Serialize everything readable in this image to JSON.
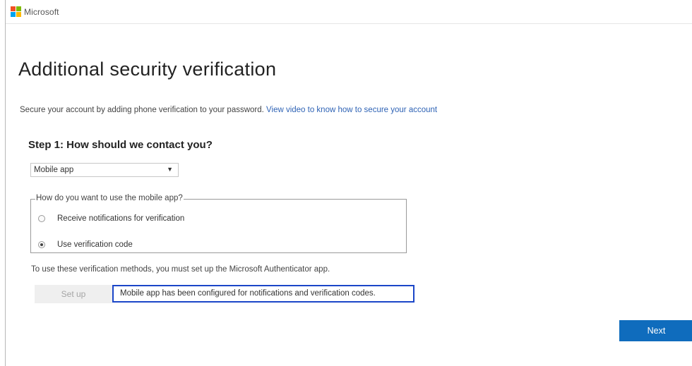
{
  "brand": {
    "name": "Microsoft",
    "logo_colors": [
      "#f25022",
      "#7fba00",
      "#00a4ef",
      "#ffb900"
    ]
  },
  "page": {
    "title": "Additional security verification",
    "intro_text": "Secure your account by adding phone verification to your password.",
    "intro_link": "View video to know how to secure your account"
  },
  "step1": {
    "heading": "Step 1: How should we contact you?",
    "contact_method": {
      "selected": "Mobile app",
      "arrow_icon": "dropdown-arrow"
    },
    "mobile_app_group": {
      "legend": "How do you want to use the mobile app?",
      "options": [
        {
          "label": "Receive notifications for verification",
          "checked": false
        },
        {
          "label": "Use verification code",
          "checked": true
        }
      ]
    },
    "authenticator_note": "To use these verification methods, you must set up the Microsoft Authenticator app.",
    "setup_button": "Set up",
    "status_message": "Mobile app has been configured for notifications and verification codes."
  },
  "footer": {
    "next_button": "Next"
  },
  "colors": {
    "accent": "#0f6cbd",
    "link": "#2f63b5",
    "highlight_border": "#1b46c8"
  }
}
